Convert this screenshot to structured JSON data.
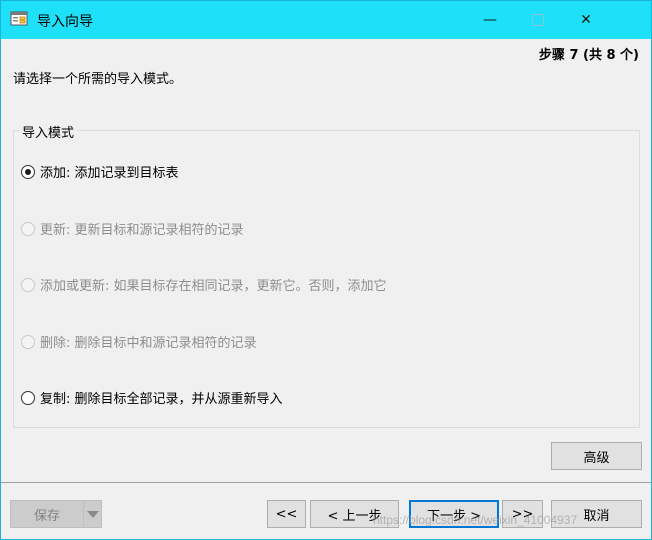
{
  "window": {
    "title": "导入向导",
    "icon": "import-wizard-icon",
    "controls": {
      "minimize": "—",
      "close": "✕"
    }
  },
  "step": {
    "label": "步骤 7 (共 8 个)"
  },
  "instruction": "请选择一个所需的导入模式。",
  "import_mode": {
    "title": "导入模式",
    "options": [
      {
        "label": "添加: 添加记录到目标表",
        "selected": true,
        "enabled": true
      },
      {
        "label": "更新: 更新目标和源记录相符的记录",
        "selected": false,
        "enabled": false
      },
      {
        "label": "添加或更新: 如果目标存在相同记录，更新它。否则，添加它",
        "selected": false,
        "enabled": false
      },
      {
        "label": "删除: 删除目标中和源记录相符的记录",
        "selected": false,
        "enabled": false
      },
      {
        "label": "复制: 删除目标全部记录，并从源重新导入",
        "selected": false,
        "enabled": true
      }
    ]
  },
  "buttons": {
    "advanced": "高级",
    "save": "保存",
    "first": "<<",
    "prev": "< 上一步",
    "next": "下一步 >",
    "last": ">>",
    "cancel": "取消"
  },
  "watermark": "https://blog.csdn.net/weixin_41004937",
  "colors": {
    "titlebar": "#1ee1f9",
    "window_bg": "#f0f0f0",
    "focus": "#0078d7"
  }
}
